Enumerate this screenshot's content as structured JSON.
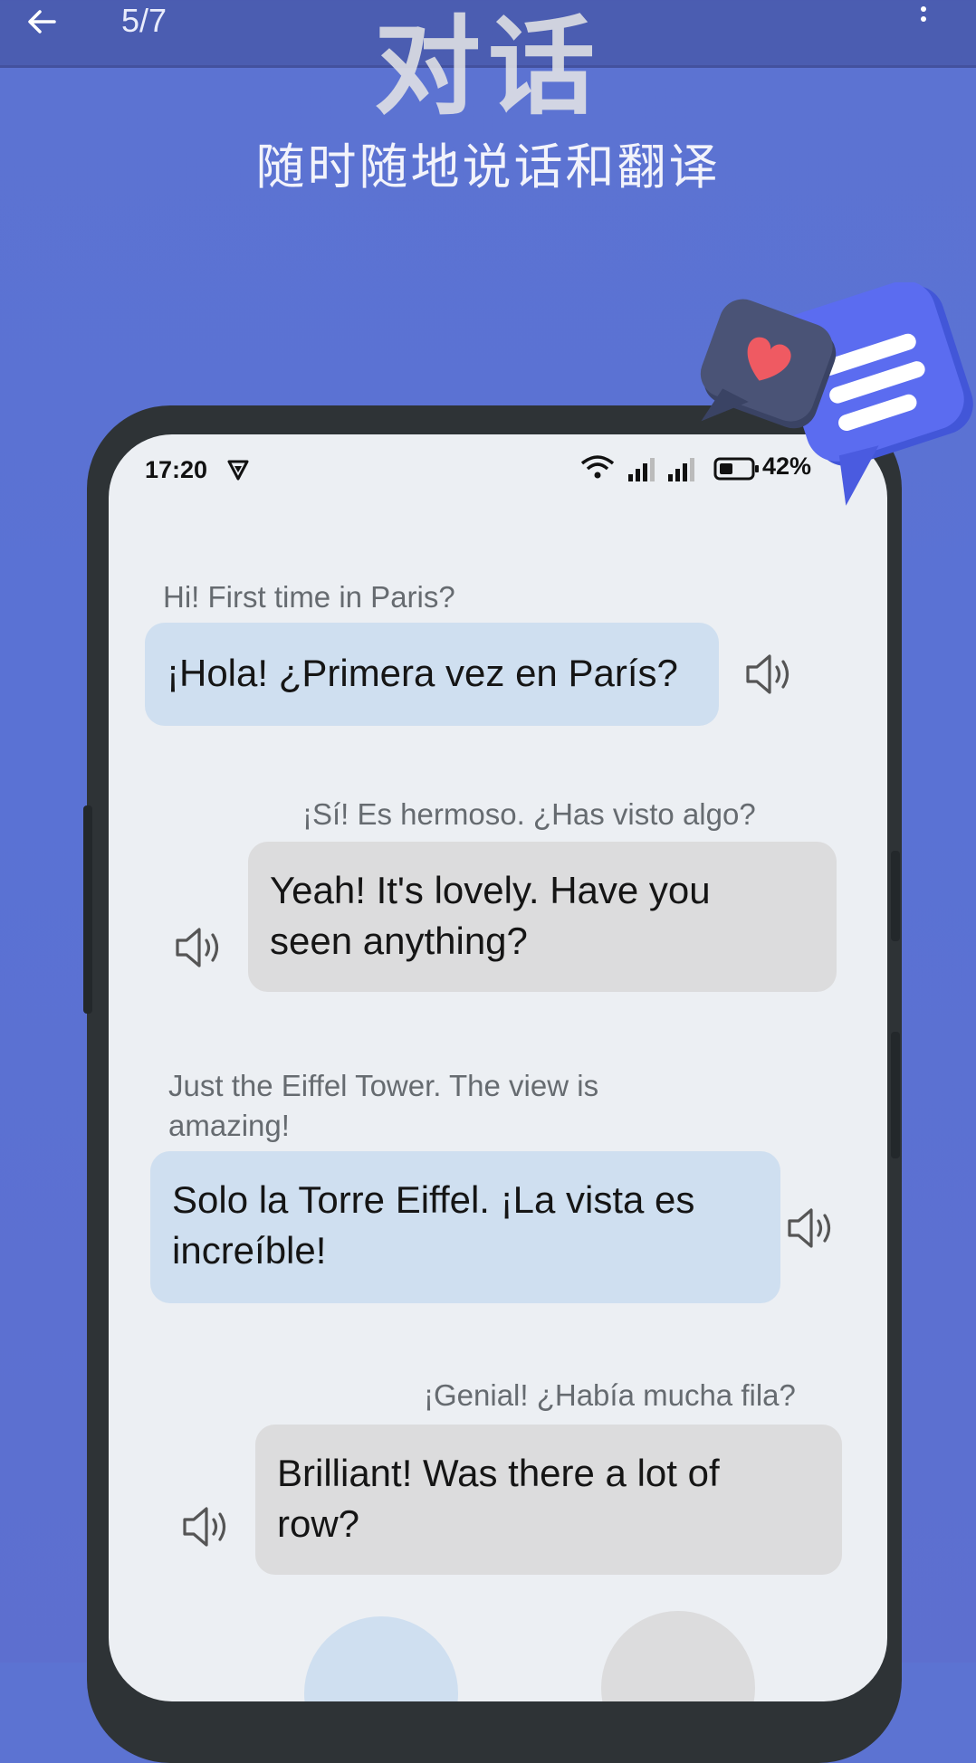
{
  "app_bar": {
    "back_icon": "arrow-left-icon",
    "page_counter": "5/7",
    "menu_icon": "more-vertical-icon"
  },
  "hero": {
    "title": "对话",
    "subtitle": "随时随地说话和翻译"
  },
  "status_bar": {
    "time": "17:20",
    "battery": "42%"
  },
  "conversation": [
    {
      "original": "Hi! First time in Paris?",
      "translation": "¡Hola! ¿Primera vez en París?",
      "side": "left"
    },
    {
      "original": "¡Sí! Es hermoso. ¿Has visto algo?",
      "translation_line1": "Yeah! It's lovely. Have you",
      "translation_line2": "seen anything?",
      "side": "right"
    },
    {
      "original_line1": "Just the Eiffel Tower. The view is",
      "original_line2": "amazing!",
      "translation_line1": "Solo la Torre Eiffel. ¡La vista es",
      "translation_line2": "increíble!",
      "side": "left"
    },
    {
      "original": "¡Genial! ¿Había mucha fila?",
      "translation_line1": "Brilliant! Was there a lot of",
      "translation_line2": "row?",
      "side": "right"
    }
  ],
  "colors": {
    "background": "#5a72d4",
    "left_bubble": "#cfdff0",
    "right_bubble": "#dcdcdd",
    "phone_frame": "#2e3336",
    "heart": "#ef5a62"
  }
}
